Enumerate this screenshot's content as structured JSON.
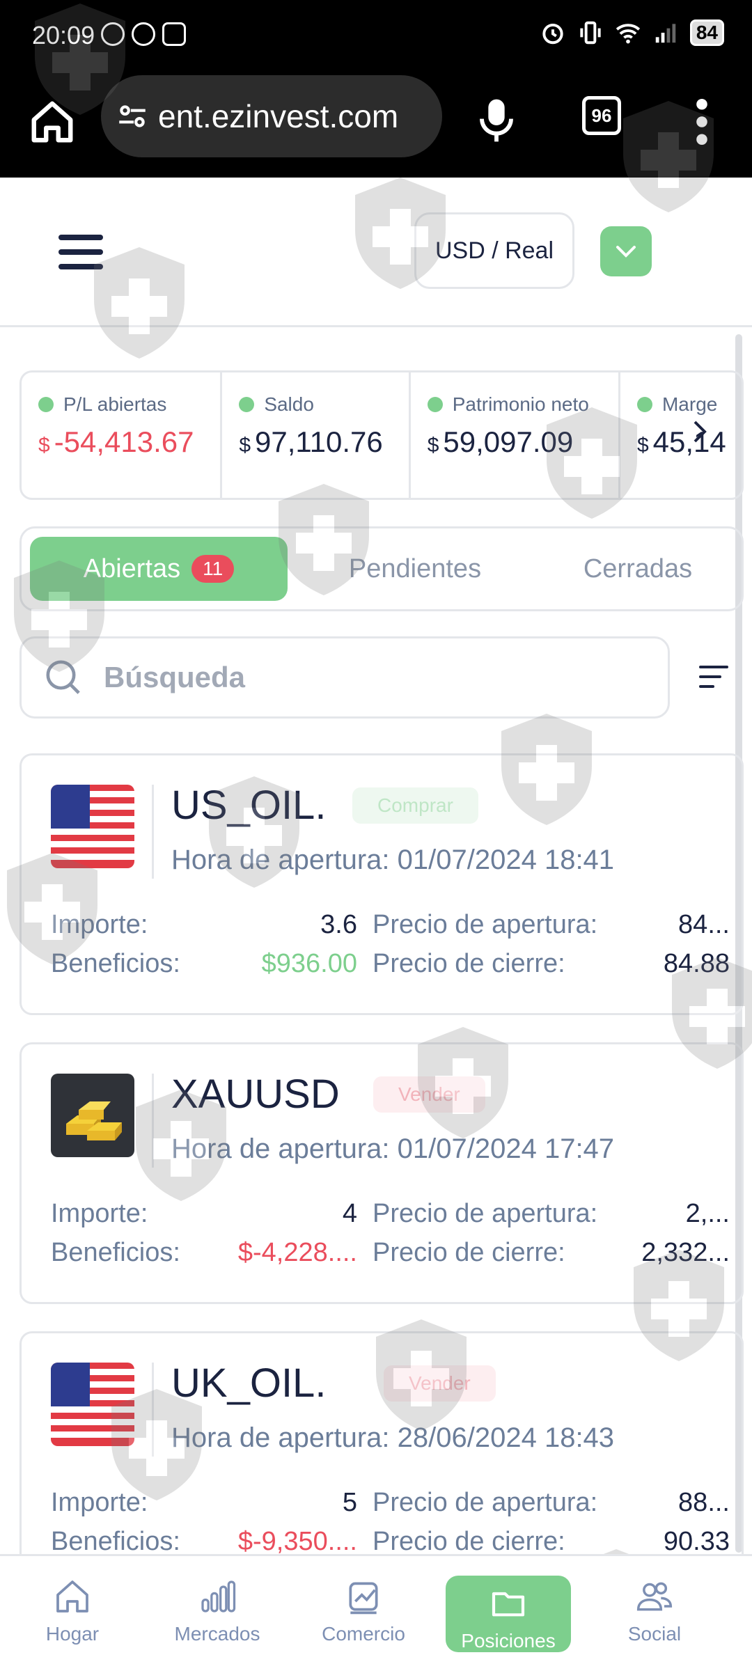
{
  "status_bar": {
    "time": "20:09",
    "battery": "84"
  },
  "browser": {
    "url": "ent.ezinvest.com",
    "tab_count": "96"
  },
  "header": {
    "account_label": "USD / Real"
  },
  "summary": [
    {
      "label": "P/L abiertas",
      "currency": "$",
      "value": "-54,413.67",
      "negative": true
    },
    {
      "label": "Saldo",
      "currency": "$",
      "value": "97,110.76",
      "negative": false
    },
    {
      "label": "Patrimonio neto",
      "currency": "$",
      "value": "59,097.09",
      "negative": false
    },
    {
      "label": "Marge",
      "currency": "$",
      "value": "45,14",
      "negative": false
    }
  ],
  "tabs": {
    "open_label": "Abiertas",
    "open_count": "11",
    "pending_label": "Pendientes",
    "closed_label": "Cerradas"
  },
  "search": {
    "placeholder": "Búsqueda"
  },
  "labels": {
    "open_time": "Hora de apertura:",
    "amount": "Importe:",
    "profit": "Beneficios:",
    "open_price": "Precio de apertura:",
    "close_price": "Precio de cierre:"
  },
  "positions": [
    {
      "symbol": "US_OIL.",
      "side": "Comprar",
      "open_time": "01/07/2024 18:41",
      "amount": "3.6",
      "profit": "$936.00",
      "open_price": "84...",
      "close_price": "84.88"
    },
    {
      "symbol": "XAUUSD",
      "side": "Vender",
      "open_time": "01/07/2024 17:47",
      "amount": "4",
      "profit": "$-4,228....",
      "open_price": "2,...",
      "close_price": "2,332..."
    },
    {
      "symbol": "UK_OIL.",
      "side": "Vender",
      "open_time": "28/06/2024 18:43",
      "amount": "5",
      "profit": "$-9,350....",
      "open_price": "88...",
      "close_price": "90.33"
    }
  ],
  "bottom_nav": {
    "home": "Hogar",
    "markets": "Mercados",
    "trade": "Comercio",
    "positions": "Posiciones",
    "social": "Social"
  },
  "colors": {
    "accent_green": "#7dcf8d",
    "loss_red": "#ea4d5c",
    "text_dark": "#1b2340",
    "text_muted": "#6b7d99"
  }
}
